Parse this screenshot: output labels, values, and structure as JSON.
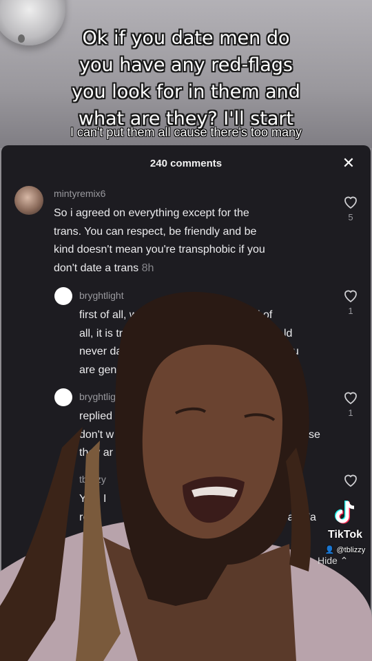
{
  "overlay": {
    "headline_lines": [
      "Ok if you date men do",
      "you have any red-flags",
      "you look for in them and",
      "what are they? I'll start"
    ],
    "caption": "I can't put them all cause there's too many"
  },
  "comments_panel": {
    "title": "240 comments",
    "close_icon": "close-icon",
    "comments": [
      {
        "username": "mintyremix6",
        "lines": [
          "So i agreed on everything except for the",
          "trans. You can respect, be friendly and be",
          "kind doesn't mean you're transphobic if you"
        ],
        "last_line": "don't date a trans",
        "time": "8h",
        "likes": "5"
      },
      {
        "username": "bryghtlight",
        "lines": [
          "first of all, we're not \"a trans\". second of",
          "all, it is transph",
          "never date a",
          "are genera"
        ],
        "lines_right": [
          "",
          "ld",
          "you",
          ""
        ],
        "likes": "1"
      },
      {
        "username": "bryghtligh",
        "lines": [
          "replied",
          "don't w",
          "they ar"
        ],
        "lines_right": [
          "",
          "se",
          ""
        ],
        "likes": "1"
      },
      {
        "username": "tblizzy",
        "lines": [
          "Yes. I",
          "res"
        ],
        "lines_right": [
          "aying, I",
          "ver date \"a"
        ],
        "likes": ""
      }
    ]
  },
  "watermark": {
    "brand": "TikTok",
    "handle": "@tblizzy",
    "hide_label": "Hide"
  },
  "colors": {
    "panel_bg": "#1d1c21",
    "text": "#ececee",
    "muted": "#9a9a9f"
  }
}
